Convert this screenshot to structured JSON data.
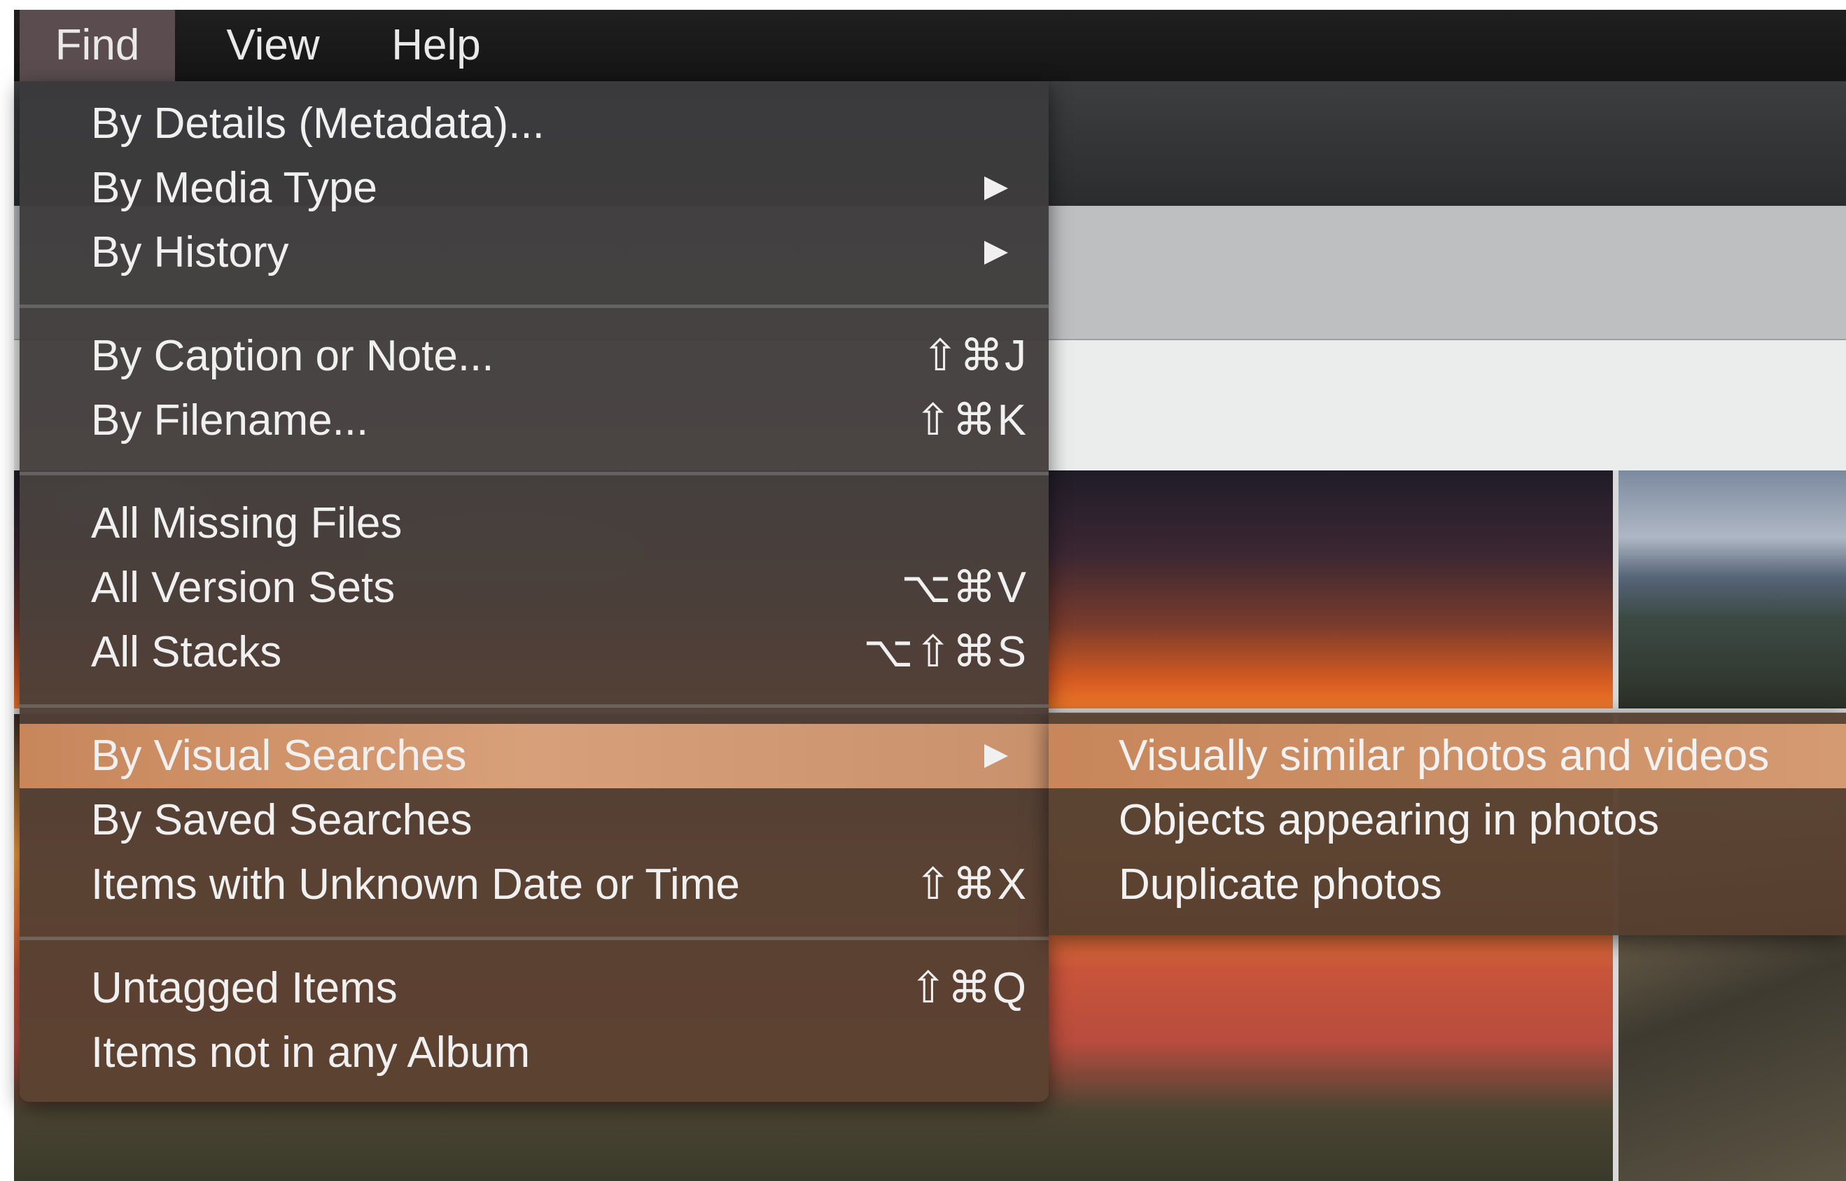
{
  "menubar": {
    "items": [
      {
        "label": "Find",
        "active": true
      },
      {
        "label": "View"
      },
      {
        "label": "Help"
      }
    ]
  },
  "find_menu": {
    "items": [
      {
        "label": "By Details (Metadata)...",
        "shortcut": "",
        "submenu": false
      },
      {
        "label": "By Media Type",
        "shortcut": "",
        "submenu": true
      },
      {
        "label": "By History",
        "shortcut": "",
        "submenu": true
      },
      {
        "label": "By Caption or Note...",
        "shortcut": "⇧⌘J",
        "submenu": false
      },
      {
        "label": "By Filename...",
        "shortcut": "⇧⌘K",
        "submenu": false
      },
      {
        "label": "All Missing Files",
        "shortcut": "",
        "submenu": false
      },
      {
        "label": "All Version Sets",
        "shortcut": "⌥⌘V",
        "submenu": false
      },
      {
        "label": "All Stacks",
        "shortcut": "⌥⇧⌘S",
        "submenu": false
      },
      {
        "label": "By Visual Searches",
        "shortcut": "",
        "submenu": true,
        "highlighted": true
      },
      {
        "label": "By Saved Searches",
        "shortcut": "",
        "submenu": false
      },
      {
        "label": "Items with Unknown Date or Time",
        "shortcut": "⇧⌘X",
        "submenu": false
      },
      {
        "label": "Untagged Items",
        "shortcut": "⇧⌘Q",
        "submenu": false
      },
      {
        "label": "Items not in any Album",
        "shortcut": "",
        "submenu": false
      }
    ]
  },
  "visual_searches_submenu": {
    "items": [
      {
        "label": "Visually similar photos and videos",
        "highlighted": true
      },
      {
        "label": "Objects appearing in photos"
      },
      {
        "label": "Duplicate photos"
      }
    ]
  },
  "colors": {
    "menubar_bg": "#1a1a1a",
    "highlight": "#d09670",
    "menu_text": "#f0f0f0"
  }
}
